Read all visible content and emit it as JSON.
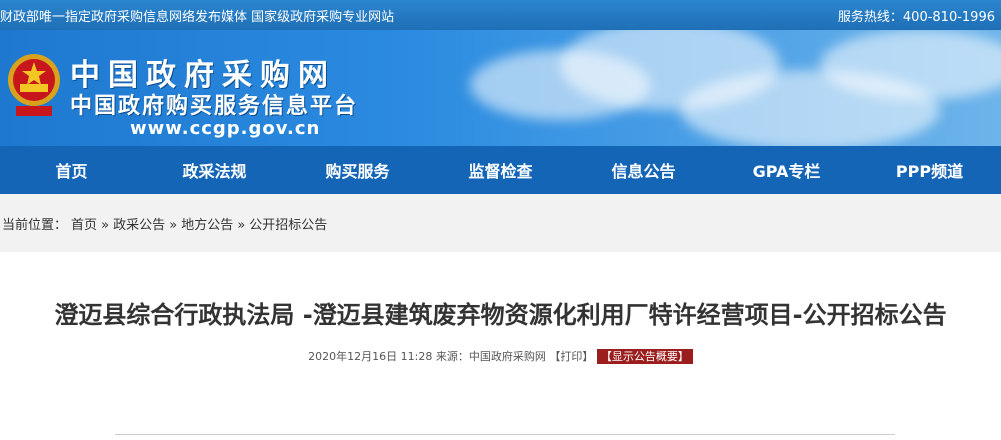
{
  "topbar": {
    "left_text": "财政部唯一指定政府采购信息网络发布媒体 国家级政府采购专业网站",
    "hotline": "服务热线：400-810-1996"
  },
  "banner": {
    "title": "中国政府采购网",
    "subtitle": "中国政府购买服务信息平台",
    "url": "www.ccgp.gov.cn"
  },
  "nav": {
    "items": [
      "首页",
      "政采法规",
      "购买服务",
      "监督检查",
      "信息公告",
      "GPA专栏",
      "PPP频道"
    ]
  },
  "breadcrumb": {
    "prefix": "当前位置：",
    "items": [
      "首页 »",
      "政采公告 »",
      "地方公告 »",
      "公开招标公告"
    ]
  },
  "article": {
    "title": "澄迈县综合行政执法局 -澄迈县建筑废弃物资源化利用厂特许经营项目-公开招标公告",
    "date": "2020年12月16日 11:28",
    "source_label": "来源：",
    "source": "中国政府采购网",
    "print": "【打印】",
    "summary_badge": "【显示公告概要】"
  },
  "colors": {
    "nav_bg": "#1565b7",
    "badge_bg": "#9b1d1d"
  }
}
